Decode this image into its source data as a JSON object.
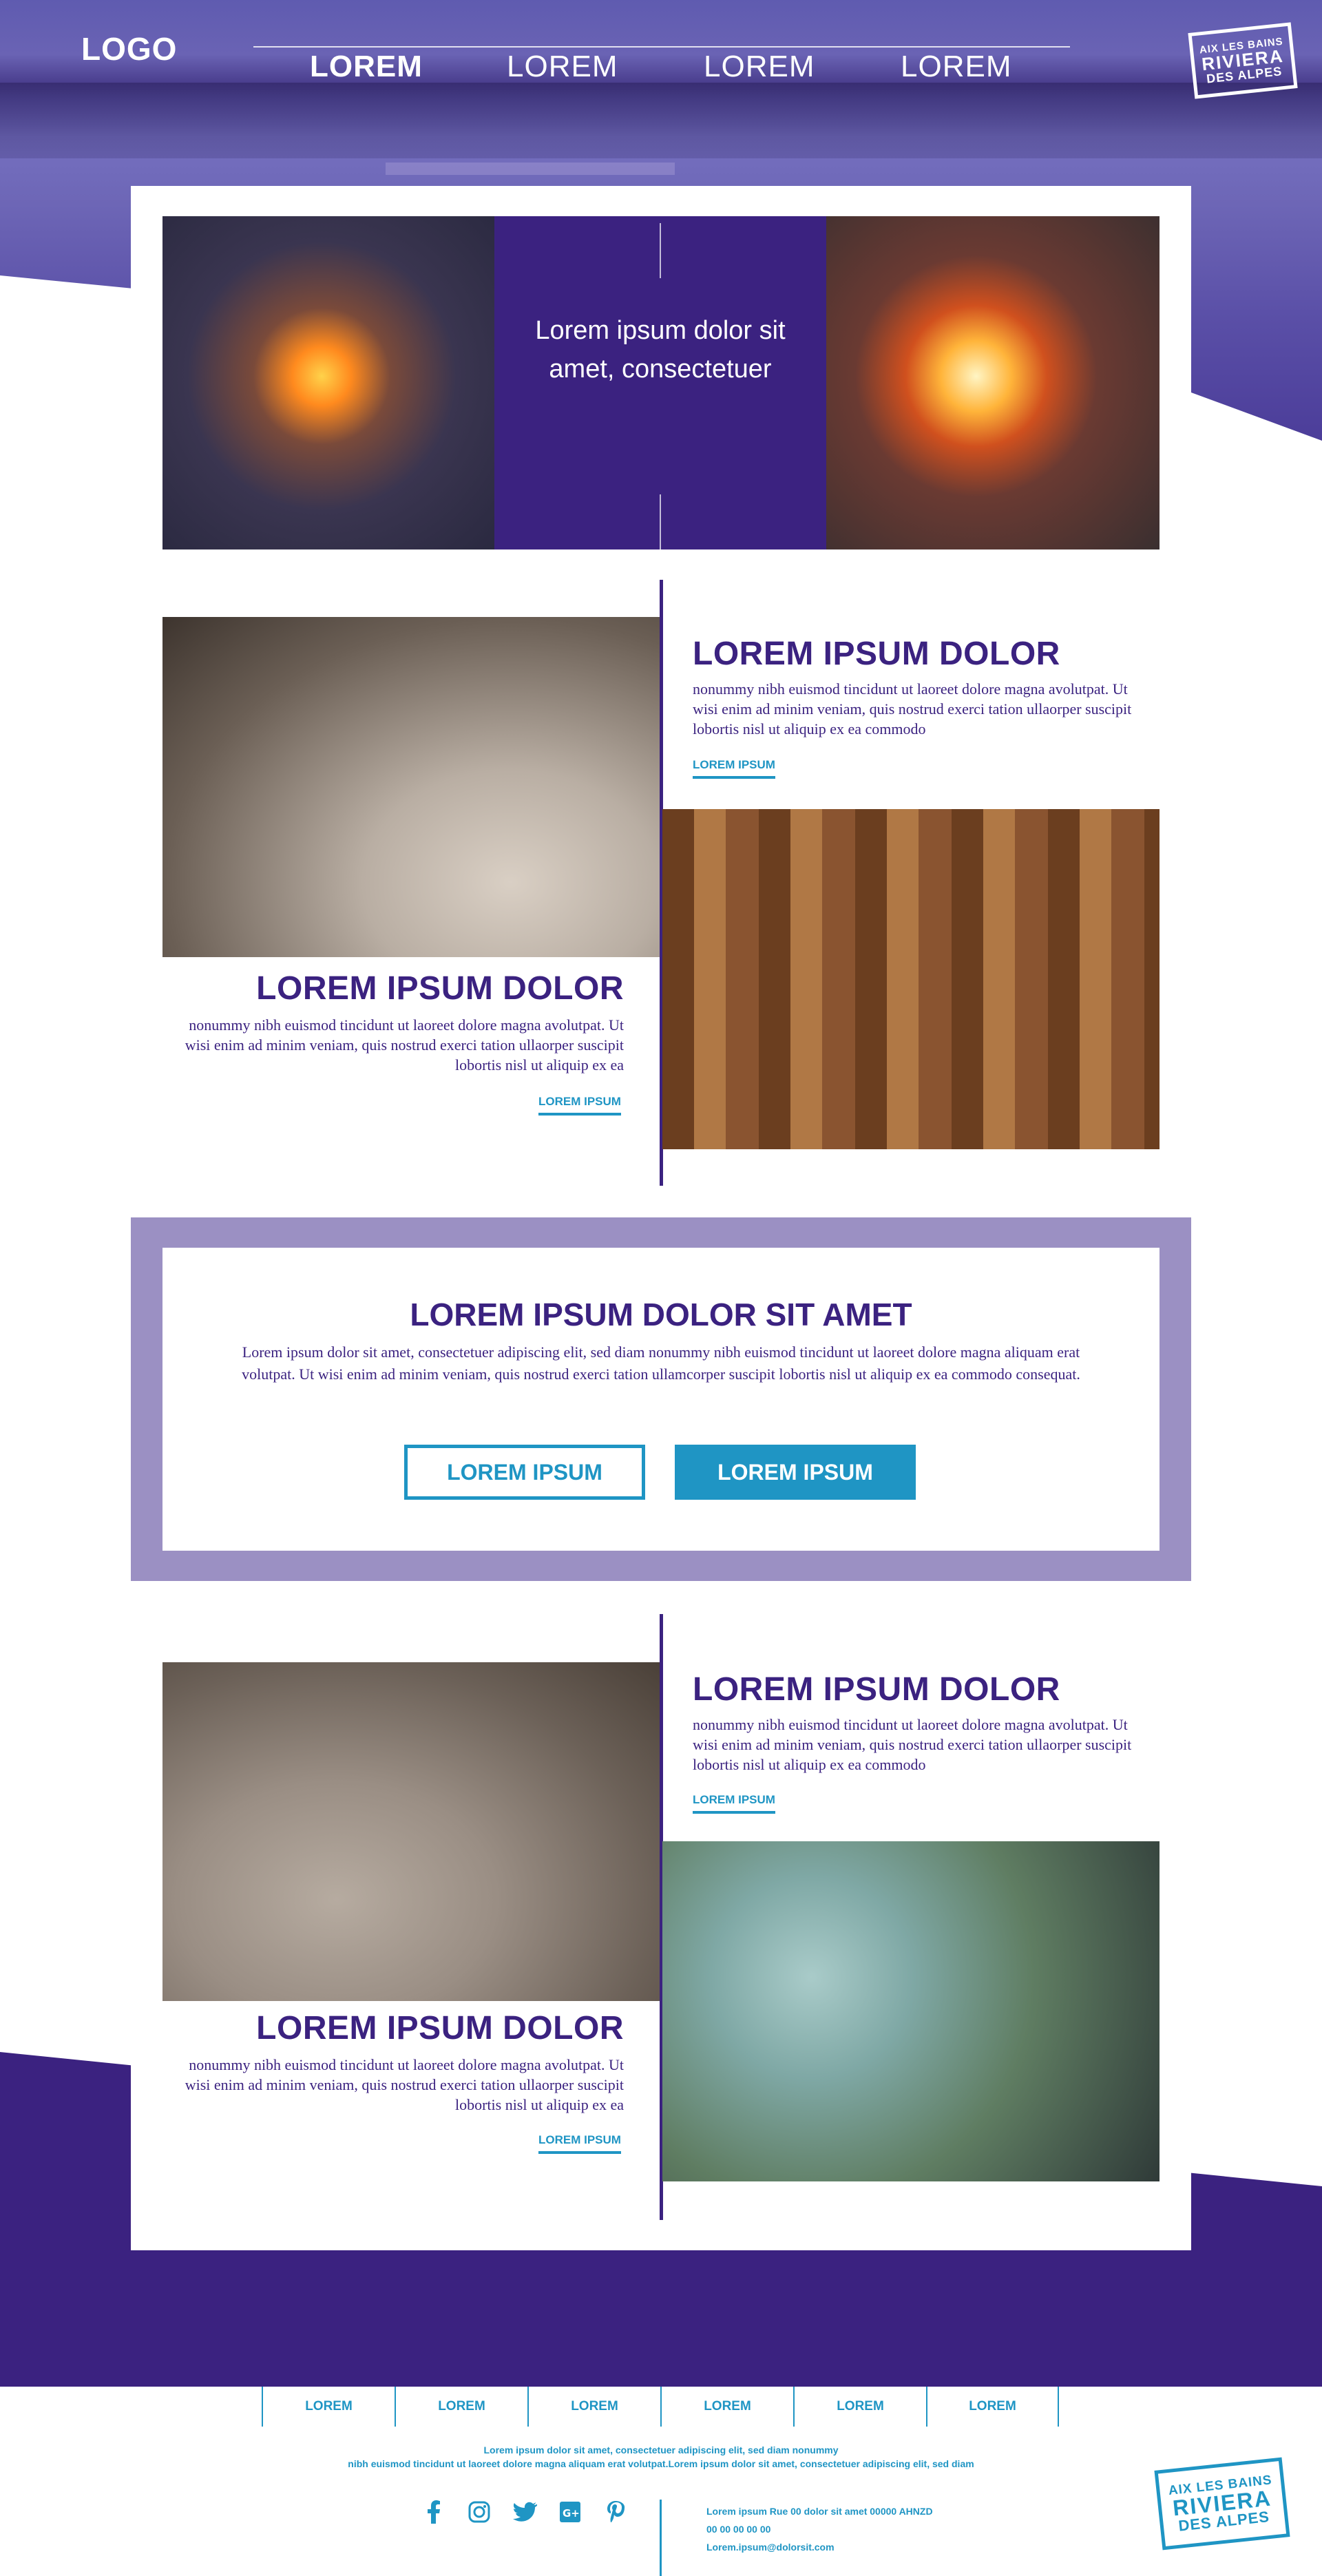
{
  "header": {
    "logo": "LOGO",
    "nav": [
      "LOREM",
      "LOREM",
      "LOREM",
      "LOREM"
    ],
    "stamp": {
      "line1": "AIX LES BAINS",
      "line2": "RIVIERA",
      "line3": "DES ALPES"
    }
  },
  "intro": {
    "text": "Lorem ipsum dolor sit amet, consectetuer"
  },
  "feature1": {
    "right": {
      "title": "LOREM IPSUM DOLOR",
      "body": "nonummy nibh euismod tincidunt ut laoreet dolore magna avolutpat. Ut wisi enim ad minim veniam, quis nostrud exerci tation ullaorper suscipit lobortis nisl ut aliquip ex ea commodo",
      "link": "LOREM IPSUM"
    },
    "left": {
      "title": "LOREM IPSUM DOLOR",
      "body": "nonummy nibh euismod tincidunt ut laoreet dolore magna avolutpat. Ut wisi enim ad minim veniam, quis nostrud exerci tation ullaorper suscipit lobortis nisl ut aliquip ex ea",
      "link": "LOREM IPSUM"
    }
  },
  "cta": {
    "title": "LOREM IPSUM DOLOR SIT AMET",
    "body": "Lorem ipsum dolor sit amet, consectetuer adipiscing elit, sed diam nonummy nibh euismod tincidunt ut laoreet dolore magna aliquam erat volutpat. Ut wisi enim ad minim veniam, quis nostrud exerci tation ullamcorper suscipit lobortis nisl ut aliquip ex ea commodo consequat.",
    "button_outline": "LOREM IPSUM",
    "button_solid": "LOREM IPSUM"
  },
  "feature2": {
    "right": {
      "title": "LOREM IPSUM DOLOR",
      "body": "nonummy nibh euismod tincidunt ut laoreet dolore magna avolutpat. Ut wisi enim ad minim veniam, quis nostrud exerci tation ullaorper suscipit lobortis nisl ut aliquip ex ea commodo",
      "link": "LOREM IPSUM"
    },
    "left": {
      "title": "LOREM IPSUM DOLOR",
      "body": "nonummy nibh euismod tincidunt ut laoreet dolore magna avolutpat. Ut wisi enim ad minim veniam, quis nostrud exerci tation ullaorper suscipit lobortis nisl ut aliquip ex ea",
      "link": "LOREM IPSUM"
    }
  },
  "footer": {
    "nav": [
      "LOREM",
      "LOREM",
      "LOREM",
      "LOREM",
      "LOREM",
      "LOREM"
    ],
    "text_line1": "Lorem ipsum dolor sit amet, consectetuer adipiscing elit, sed diam nonummy",
    "text_line2": "nibh euismod tincidunt ut laoreet dolore magna aliquam erat volutpat.Lorem ipsum dolor sit amet, consectetuer adipiscing elit, sed diam",
    "socials": [
      "facebook-icon",
      "instagram-icon",
      "twitter-icon",
      "google-plus-icon",
      "pinterest-icon"
    ],
    "contact": {
      "address": "Lorem ipsum Rue 00 dolor sit amet 00000 AHNZD",
      "phone": "00 00 00 00 00",
      "email": "Lorem.ipsum@dolorsit.com"
    },
    "stamp": {
      "line1": "AIX LES BAINS",
      "line2": "RIVIERA",
      "line3": "DES ALPES"
    }
  },
  "colors": {
    "primary_purple": "#3b2280",
    "lavender": "#9b90c3",
    "teal": "#1f95c4"
  }
}
